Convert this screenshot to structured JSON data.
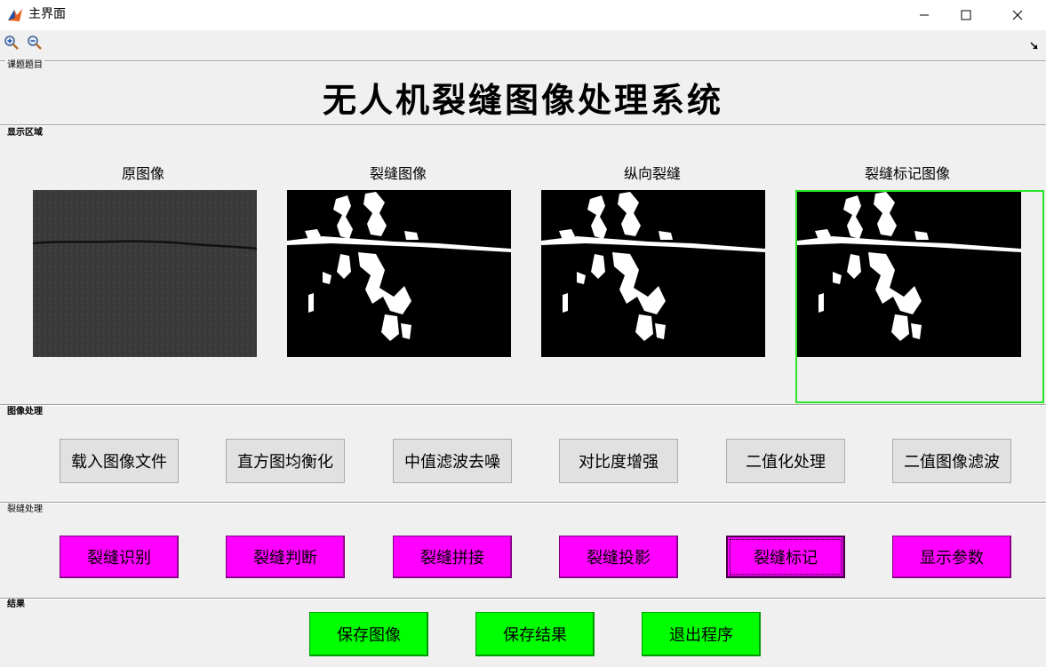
{
  "window": {
    "title": "主界面",
    "icon": "matlab-figure-icon"
  },
  "toolbar": {
    "tools": [
      "zoom-in-icon",
      "zoom-out-icon"
    ]
  },
  "panels": {
    "title_panel": "课题题目",
    "display_panel": "显示区域",
    "image_processing_panel": "图像处理",
    "crack_processing_panel": "裂缝处理",
    "result_panel": "结果"
  },
  "system_title": "无人机裂缝图像处理系统",
  "images": [
    {
      "label": "原图像"
    },
    {
      "label": "裂缝图像"
    },
    {
      "label": "纵向裂缝"
    },
    {
      "label": "裂缝标记图像"
    }
  ],
  "image_processing_buttons": [
    "载入图像文件",
    "直方图均衡化",
    "中值滤波去噪",
    "对比度增强",
    "二值化处理",
    "二值图像滤波"
  ],
  "crack_processing_buttons": [
    "裂缝识别",
    "裂缝判断",
    "裂缝拼接",
    "裂缝投影",
    "裂缝标记",
    "显示参数"
  ],
  "result_buttons": [
    "保存图像",
    "保存结果",
    "退出程序"
  ],
  "colors": {
    "magenta_button": "#ff00ff",
    "green_button": "#00ff00",
    "highlight_frame": "#27e827"
  }
}
